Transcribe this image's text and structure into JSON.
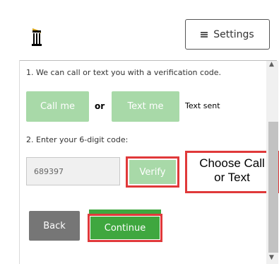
{
  "header": {
    "logo_icon": "university-tower-logo",
    "settings_label": "Settings",
    "settings_icon": "hamburger-icon"
  },
  "step1": {
    "label": "1. We can call or text you with a verification code.",
    "call_label": "Call me",
    "or_label": "or",
    "text_label": "Text me",
    "status": "Text sent"
  },
  "step2": {
    "label": "2. Enter your 6-digit code:",
    "code_value": "689397",
    "verify_label": "Verify"
  },
  "callout": {
    "line1": "Choose Call",
    "line2": "or Text"
  },
  "actions": {
    "back_label": "Back",
    "continue_label": "Continue"
  },
  "colors": {
    "disabled_green": "#a8d9a8",
    "active_green": "#3fa73f",
    "back_gray": "#767676",
    "highlight_red": "#e0393a"
  }
}
